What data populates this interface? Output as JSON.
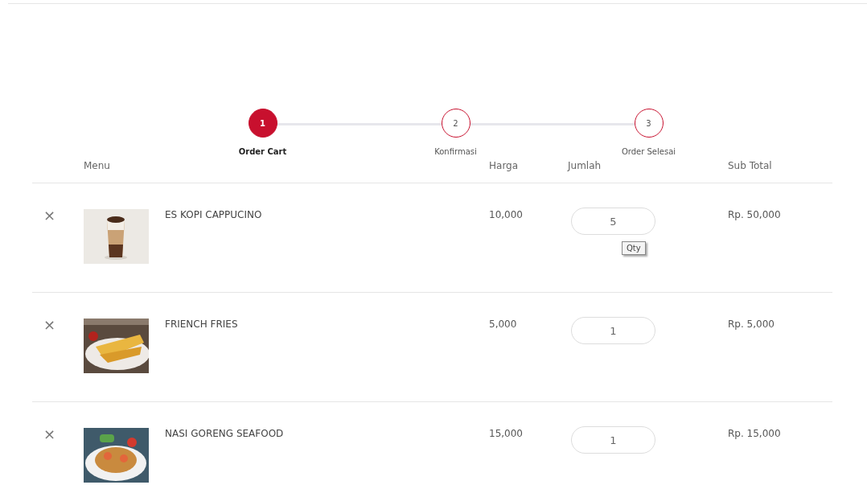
{
  "steps": [
    {
      "number": "1",
      "label": "Order Cart",
      "selected": true
    },
    {
      "number": "2",
      "label": "Konfirmasi",
      "selected": false
    },
    {
      "number": "3",
      "label": "Order Selesai",
      "selected": false
    }
  ],
  "table": {
    "columns": [
      "Menu",
      "Harga",
      "Jumlah",
      "Sub Total"
    ],
    "rows": [
      {
        "remove": "×",
        "kind": "coffee",
        "name": "ES KOPI CAPPUCINO",
        "price": "10,000",
        "qty": "5",
        "tooltip": "Qty",
        "subtotal": "Rp. 50,000"
      },
      {
        "remove": "×",
        "kind": "fries",
        "name": "FRIENCH FRIES",
        "price": "5,000",
        "qty": "1",
        "subtotal": "Rp. 5,000"
      },
      {
        "remove": "×",
        "kind": "rice",
        "name": "NASI GORENG SEAFOOD",
        "price": "15,000",
        "qty": "1",
        "subtotal": "Rp. 15,000"
      }
    ]
  }
}
